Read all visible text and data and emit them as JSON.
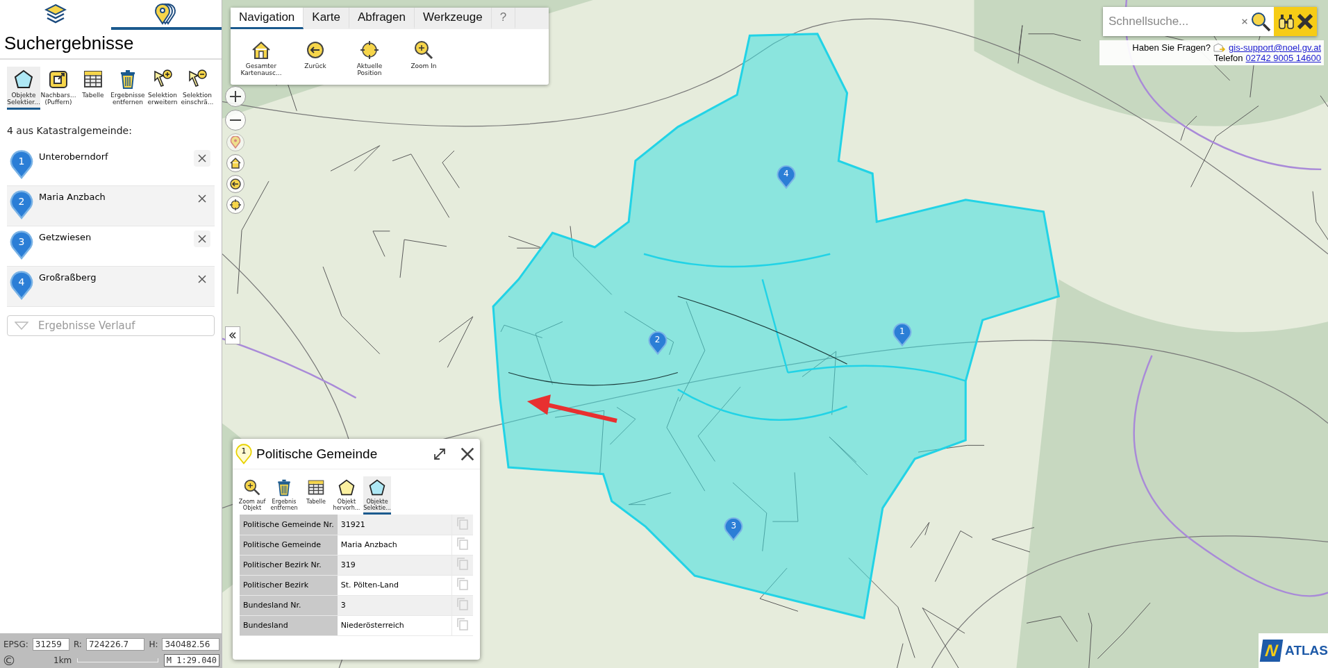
{
  "sidebar": {
    "tabs": [
      {
        "kind": "layers",
        "selected": false
      },
      {
        "kind": "results",
        "selected": true
      }
    ],
    "title": "Suchergebnisse",
    "tools": [
      {
        "kind": "polygon",
        "label": "Objekte\nSelektier...",
        "selected": true
      },
      {
        "kind": "buffer",
        "label": "Nachbars...\n(Puffern)",
        "selected": false
      },
      {
        "kind": "table",
        "label": "Tabelle",
        "selected": false
      },
      {
        "kind": "trash",
        "label": "Ergebnisse\nentfernen",
        "selected": false
      },
      {
        "kind": "cursor-plus",
        "label": "Selektion\nerweitern",
        "selected": false
      },
      {
        "kind": "cursor-minus",
        "label": "Selektion\neinschrä...",
        "selected": false
      }
    ],
    "results_heading": "4 aus Katastralgemeinde:",
    "results": [
      {
        "number": "1",
        "name": "Unteroberndorf"
      },
      {
        "number": "2",
        "name": "Maria Anzbach"
      },
      {
        "number": "3",
        "name": "Getzwiesen"
      },
      {
        "number": "4",
        "name": "Großraßberg"
      }
    ],
    "history": {
      "placeholder": "Ergebnisse Verlauf",
      "expanded": false
    },
    "status": {
      "epsg_label": "EPSG:",
      "epsg": "31259",
      "r_label": "R:",
      "r": "724226.7",
      "h_label": "H:",
      "h": "340482.56",
      "copyright": "©",
      "scale_label": "1km",
      "scale": "M 1:29.040"
    }
  },
  "toolbar": {
    "tabs": [
      {
        "label": "Navigation",
        "selected": true
      },
      {
        "label": "Karte",
        "selected": false
      },
      {
        "label": "Abfragen",
        "selected": false
      },
      {
        "label": "Werkzeuge",
        "selected": false
      },
      {
        "label": "?",
        "selected": false
      }
    ],
    "tools": [
      {
        "kind": "home",
        "label": "Gesamter\nKartenausc..."
      },
      {
        "kind": "back",
        "label": "Zurück"
      },
      {
        "kind": "position",
        "label": "Aktuelle\nPosition"
      },
      {
        "kind": "zoom",
        "label": "Zoom In"
      }
    ]
  },
  "map": {
    "controls": [
      {
        "kind": "zoom-in"
      },
      {
        "kind": "zoom-out"
      },
      {
        "kind": "pin",
        "disabled": true
      },
      {
        "kind": "home",
        "disabled": false
      },
      {
        "kind": "back",
        "disabled": false
      },
      {
        "kind": "position",
        "disabled": false
      }
    ],
    "markers": [
      {
        "number": "4"
      },
      {
        "number": "2"
      },
      {
        "number": "1"
      },
      {
        "number": "3"
      }
    ]
  },
  "search": {
    "placeholder": "Schnellsuche..."
  },
  "contact": {
    "question": "Haben Sie Fragen?",
    "email": "gis-support@noel.gv.at",
    "phone_label": "Telefon",
    "phone": "02742 9005 14600"
  },
  "popup": {
    "number": "1",
    "title": "Politische Gemeinde",
    "tools": [
      {
        "kind": "zoom",
        "label": "Zoom auf\nObjekt",
        "selected": false
      },
      {
        "kind": "trash",
        "label": "Ergebnis\nentfernen",
        "selected": false
      },
      {
        "kind": "table",
        "label": "Tabelle",
        "selected": false
      },
      {
        "kind": "polygon-yellow",
        "label": "Objekt\nhervorh...",
        "selected": false
      },
      {
        "kind": "polygon",
        "label": "Objekte\nSelektie...",
        "selected": true
      }
    ],
    "rows": [
      {
        "label": "Politische Gemeinde Nr.",
        "value": "31921"
      },
      {
        "label": "Politische Gemeinde",
        "value": "Maria Anzbach"
      },
      {
        "label": "Politischer Bezirk Nr.",
        "value": "319"
      },
      {
        "label": "Politischer Bezirk",
        "value": "St. Pölten-Land"
      },
      {
        "label": "Bundesland Nr.",
        "value": "3"
      },
      {
        "label": "Bundesland",
        "value": "Niederösterreich"
      }
    ]
  },
  "logo": {
    "mark": "N",
    "name": "ATLAS"
  }
}
